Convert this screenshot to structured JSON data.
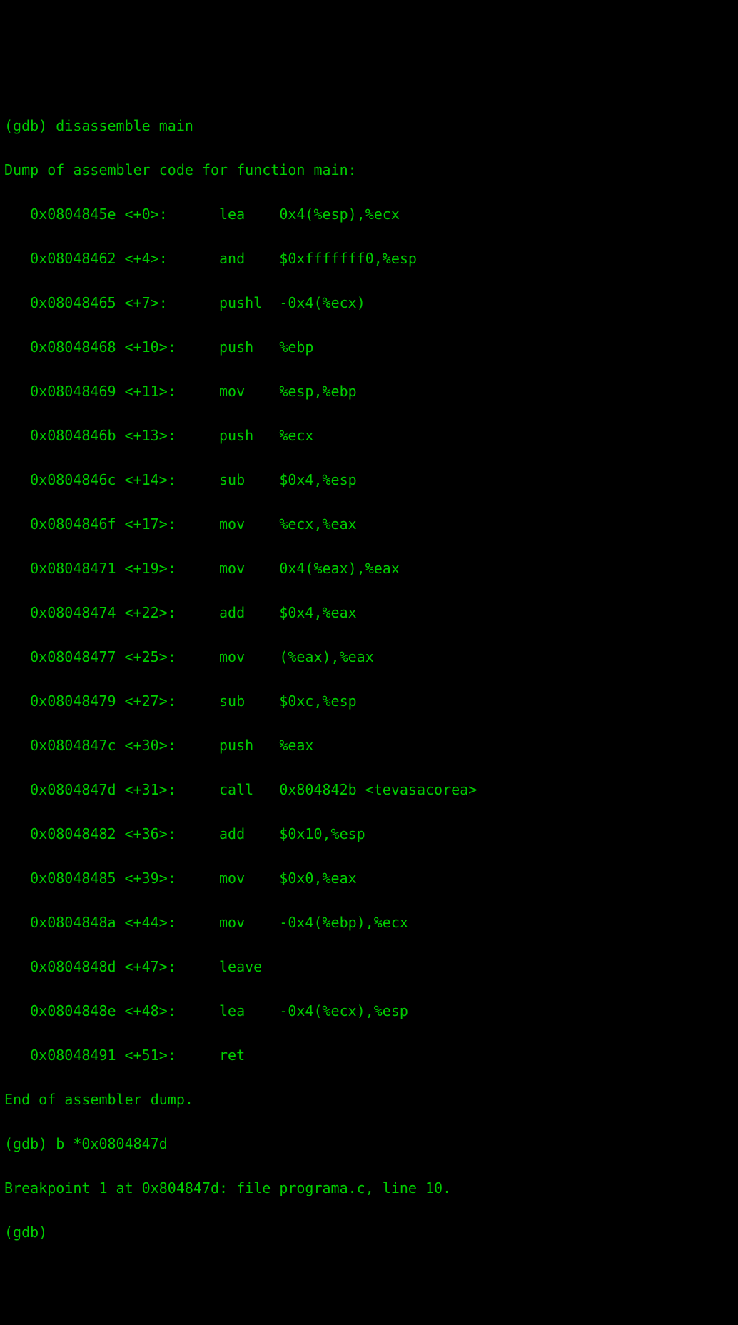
{
  "gdb": {
    "prompt": "(gdb) ",
    "cmd_disasm": "disassemble main",
    "dump_header": "Dump of assembler code for function main:",
    "asm": [
      {
        "addr": "0x0804845e",
        "offset": "<+0>:",
        "mnem": "lea",
        "oper": "0x4(%esp),%ecx"
      },
      {
        "addr": "0x08048462",
        "offset": "<+4>:",
        "mnem": "and",
        "oper": "$0xfffffff0,%esp"
      },
      {
        "addr": "0x08048465",
        "offset": "<+7>:",
        "mnem": "pushl",
        "oper": "-0x4(%ecx)"
      },
      {
        "addr": "0x08048468",
        "offset": "<+10>:",
        "mnem": "push",
        "oper": "%ebp"
      },
      {
        "addr": "0x08048469",
        "offset": "<+11>:",
        "mnem": "mov",
        "oper": "%esp,%ebp"
      },
      {
        "addr": "0x0804846b",
        "offset": "<+13>:",
        "mnem": "push",
        "oper": "%ecx"
      },
      {
        "addr": "0x0804846c",
        "offset": "<+14>:",
        "mnem": "sub",
        "oper": "$0x4,%esp"
      },
      {
        "addr": "0x0804846f",
        "offset": "<+17>:",
        "mnem": "mov",
        "oper": "%ecx,%eax"
      },
      {
        "addr": "0x08048471",
        "offset": "<+19>:",
        "mnem": "mov",
        "oper": "0x4(%eax),%eax"
      },
      {
        "addr": "0x08048474",
        "offset": "<+22>:",
        "mnem": "add",
        "oper": "$0x4,%eax"
      },
      {
        "addr": "0x08048477",
        "offset": "<+25>:",
        "mnem": "mov",
        "oper": "(%eax),%eax"
      },
      {
        "addr": "0x08048479",
        "offset": "<+27>:",
        "mnem": "sub",
        "oper": "$0xc,%esp"
      },
      {
        "addr": "0x0804847c",
        "offset": "<+30>:",
        "mnem": "push",
        "oper": "%eax"
      },
      {
        "addr": "0x0804847d",
        "offset": "<+31>:",
        "mnem": "call",
        "oper": "0x804842b <tevasacorea>"
      },
      {
        "addr": "0x08048482",
        "offset": "<+36>:",
        "mnem": "add",
        "oper": "$0x10,%esp"
      },
      {
        "addr": "0x08048485",
        "offset": "<+39>:",
        "mnem": "mov",
        "oper": "$0x0,%eax"
      },
      {
        "addr": "0x0804848a",
        "offset": "<+44>:",
        "mnem": "mov",
        "oper": "-0x4(%ebp),%ecx"
      },
      {
        "addr": "0x0804848d",
        "offset": "<+47>:",
        "mnem": "leave",
        "oper": ""
      },
      {
        "addr": "0x0804848e",
        "offset": "<+48>:",
        "mnem": "lea",
        "oper": "-0x4(%ecx),%esp"
      },
      {
        "addr": "0x08048491",
        "offset": "<+51>:",
        "mnem": "ret",
        "oper": ""
      }
    ],
    "dump_footer": "End of assembler dump.",
    "cmd_break": "b *0x0804847d",
    "break_result": "Breakpoint 1 at 0x804847d: file programa.c, line 10.",
    "prompt2": "(gdb) "
  }
}
